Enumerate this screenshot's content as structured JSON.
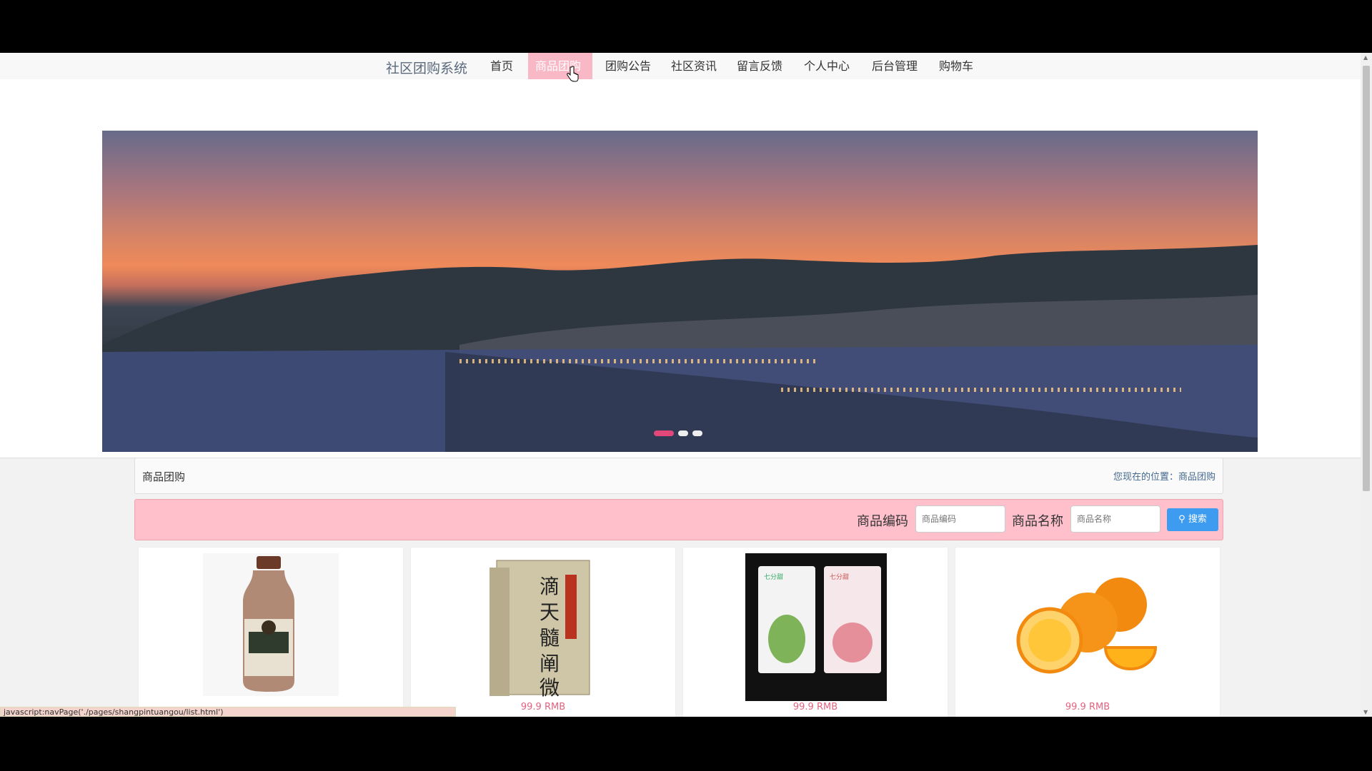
{
  "brand": "社区团购系统",
  "nav": [
    {
      "label": "首页"
    },
    {
      "label": "商品团购",
      "active": true
    },
    {
      "label": "团购公告"
    },
    {
      "label": "社区资讯"
    },
    {
      "label": "留言反馈"
    },
    {
      "label": "个人中心"
    },
    {
      "label": "后台管理"
    },
    {
      "label": "购物车"
    }
  ],
  "breadcrumb": {
    "title": "商品团购",
    "location": "您现在的位置：商品团购"
  },
  "search": {
    "code_label": "商品编码",
    "code_placeholder": "商品编码",
    "name_label": "商品名称",
    "name_placeholder": "商品名称",
    "button_label": "搜索"
  },
  "products": [
    {
      "image": "milk-tea-bottle",
      "price": ""
    },
    {
      "image": "book-box-set",
      "price": "99.9 RMB"
    },
    {
      "image": "face-mask-packs",
      "price": "99.9 RMB"
    },
    {
      "image": "oranges",
      "price": "99.9 RMB"
    }
  ],
  "status_url": "javascript:navPage('./pages/shangpintuangou/list.html')",
  "colors": {
    "accent_pink": "#ffc0cb",
    "nav_active": "#f9b8c6",
    "button_blue": "#3d9bf0",
    "price": "#e4627f"
  }
}
